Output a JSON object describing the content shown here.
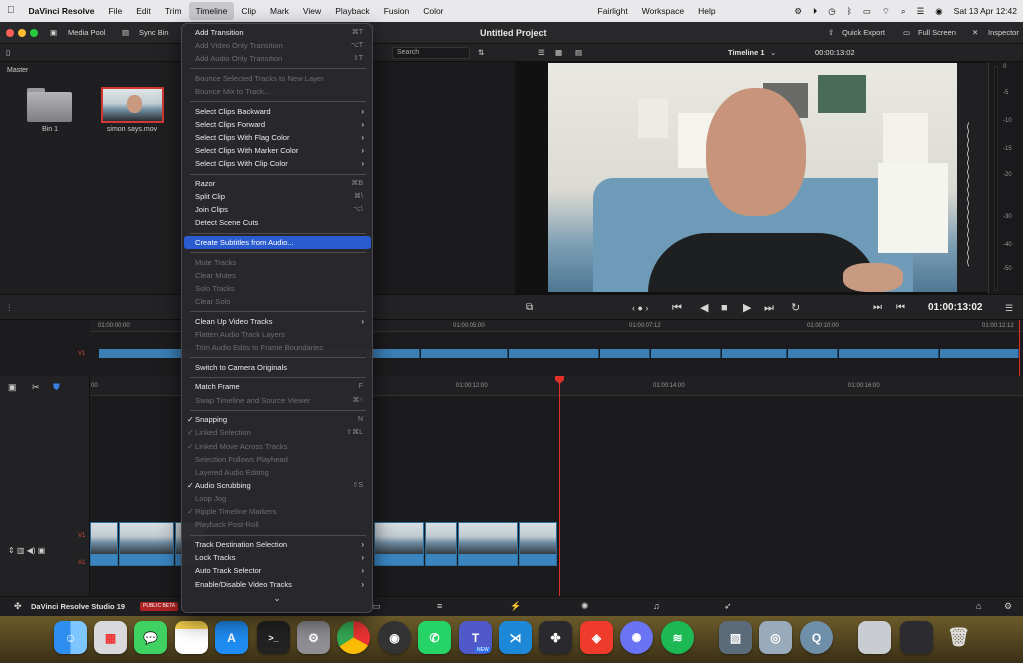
{
  "menubar": {
    "app": "DaVinci Resolve",
    "items": [
      "File",
      "Edit",
      "Trim",
      "Timeline",
      "Clip",
      "Mark",
      "View",
      "Playback",
      "Fusion",
      "Color",
      "Fairlight",
      "Workspace",
      "Help"
    ],
    "active": "Timeline",
    "datetime": "Sat 13 Apr  12:42"
  },
  "toolbar": {
    "media_pool": "Media Pool",
    "sync_bin": "Sync Bin",
    "project_title": "Untitled Project",
    "quick_export": "Quick Export",
    "full_screen": "Full Screen",
    "inspector": "Inspector"
  },
  "subbar": {
    "search_placeholder": "Search",
    "timeline_name": "Timeline 1",
    "timecode": "00:00:13:02"
  },
  "media_pool": {
    "master_label": "Master",
    "bin_label": "Bin 1",
    "clip_label": "simon says.mov"
  },
  "viewer": {
    "timecode": "01:00:13:02",
    "meter_labels": [
      "0",
      "-5",
      "-10",
      "-15",
      "-20",
      "-30",
      "-40",
      "-50"
    ]
  },
  "timeline": {
    "upper_ticks": [
      "01:00:00:00",
      "01:00:05:00",
      "01:00:07:12",
      "01:00:10:00",
      "01:00:12:12"
    ],
    "lower_ticks": [
      "00",
      "01:00:12:00",
      "01:00:14:00",
      "01:00:16:00"
    ],
    "track_v1": "V1",
    "track_a1": "A1"
  },
  "pagesbar": {
    "brand": "DaVinci Resolve Studio 19",
    "badge": "PUBLIC BETA"
  },
  "menu": {
    "items": [
      {
        "label": "Add Transition",
        "shortcut": "⌘T",
        "disabled": false
      },
      {
        "label": "Add Video Only Transition",
        "shortcut": "⌥T",
        "disabled": true
      },
      {
        "label": "Add Audio Only Transition",
        "shortcut": "⇧T",
        "disabled": true
      },
      {
        "sep": true
      },
      {
        "label": "Bounce Selected Tracks to New Layer",
        "disabled": true
      },
      {
        "label": "Bounce Mix to Track...",
        "disabled": true
      },
      {
        "sep": true
      },
      {
        "label": "Select Clips Backward",
        "submenu": true
      },
      {
        "label": "Select Clips Forward",
        "submenu": true
      },
      {
        "label": "Select Clips With Flag Color",
        "submenu": true
      },
      {
        "label": "Select Clips With Marker Color",
        "submenu": true
      },
      {
        "label": "Select Clips With Clip Color",
        "submenu": true
      },
      {
        "sep": true
      },
      {
        "label": "Razor",
        "shortcut": "⌘B"
      },
      {
        "label": "Split Clip",
        "shortcut": "⌘\\"
      },
      {
        "label": "Join Clips",
        "shortcut": "⌥\\"
      },
      {
        "label": "Detect Scene Cuts"
      },
      {
        "sep": true
      },
      {
        "label": "Create Subtitles from Audio...",
        "highlight": true
      },
      {
        "sep": true
      },
      {
        "label": "Mute Tracks",
        "disabled": true
      },
      {
        "label": "Clear Mutes",
        "disabled": true
      },
      {
        "label": "Solo Tracks",
        "disabled": true
      },
      {
        "label": "Clear Solo",
        "disabled": true
      },
      {
        "sep": true
      },
      {
        "label": "Clean Up Video Tracks",
        "submenu": true
      },
      {
        "label": "Flatten Audio Track Layers",
        "disabled": true
      },
      {
        "label": "Trim Audio Edits to Frame Boundaries",
        "disabled": true
      },
      {
        "sep": true
      },
      {
        "label": "Switch to Camera Originals"
      },
      {
        "sep": true
      },
      {
        "label": "Match Frame",
        "shortcut": "F"
      },
      {
        "label": "Swap Timeline and Source Viewer",
        "shortcut": "⌘↑",
        "disabled": true
      },
      {
        "sep": true
      },
      {
        "label": "Snapping",
        "shortcut": "N",
        "checked": true
      },
      {
        "label": "Linked Selection",
        "shortcut": "⇧⌘L",
        "checked": true,
        "disabled": true
      },
      {
        "label": "Linked Move Across Tracks",
        "checked": true,
        "disabled": true
      },
      {
        "label": "Selection Follows Playhead",
        "disabled": true
      },
      {
        "label": "Layered Audio Editing",
        "disabled": true
      },
      {
        "label": "Audio Scrubbing",
        "shortcut": "⇧S",
        "checked": true
      },
      {
        "label": "Loop Jog",
        "disabled": true
      },
      {
        "label": "Ripple Timeline Markers",
        "checked": true,
        "disabled": true
      },
      {
        "label": "Playback Post-Roll",
        "disabled": true
      },
      {
        "sep": true
      },
      {
        "label": "Track Destination Selection",
        "submenu": true
      },
      {
        "label": "Lock Tracks",
        "submenu": true
      },
      {
        "label": "Auto Track Selector",
        "submenu": true
      },
      {
        "label": "Enable/Disable Video Tracks",
        "submenu": true
      }
    ],
    "more": "⌄"
  },
  "dock": {
    "new_badge": "NEW"
  },
  "colors": {
    "highlight": "#2a5ccf",
    "clip_blue": "#3b7fb5",
    "playhead": "#e0302a"
  }
}
